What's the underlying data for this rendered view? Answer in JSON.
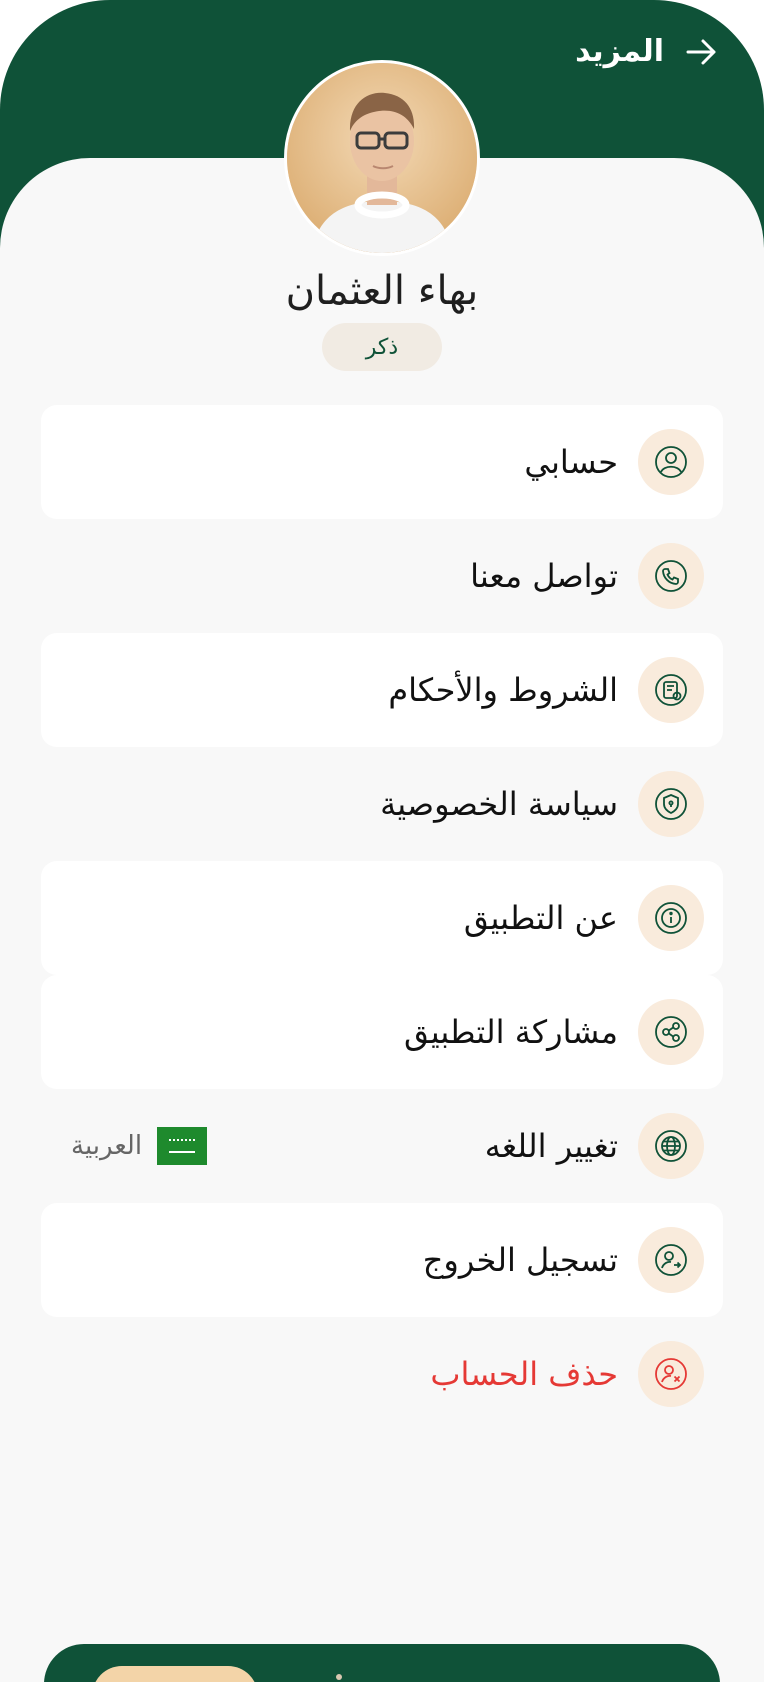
{
  "header": {
    "title": "المزيد"
  },
  "profile": {
    "name": "بهاء العثمان",
    "gender": "ذكر"
  },
  "menu": [
    {
      "label": "حسابي",
      "icon": "user-circle-icon"
    },
    {
      "label": "تواصل معنا",
      "icon": "phone-icon"
    },
    {
      "label": "الشروط والأحكام",
      "icon": "document-icon"
    },
    {
      "label": "سياسة الخصوصية",
      "icon": "shield-icon"
    },
    {
      "label": "عن التطبيق",
      "icon": "info-icon"
    },
    {
      "label": "مشاركة التطبيق",
      "icon": "share-icon"
    },
    {
      "label": "تغيير اللغه",
      "icon": "globe-icon",
      "value": "العربية"
    },
    {
      "label": "تسجيل الخروج",
      "icon": "logout-icon"
    },
    {
      "label": "حذف الحساب",
      "icon": "delete-user-icon"
    }
  ],
  "colors": {
    "primary": "#0f5238",
    "icon_bg": "#f9ebdc",
    "danger": "#e53935",
    "background": "#f8f8f8"
  }
}
